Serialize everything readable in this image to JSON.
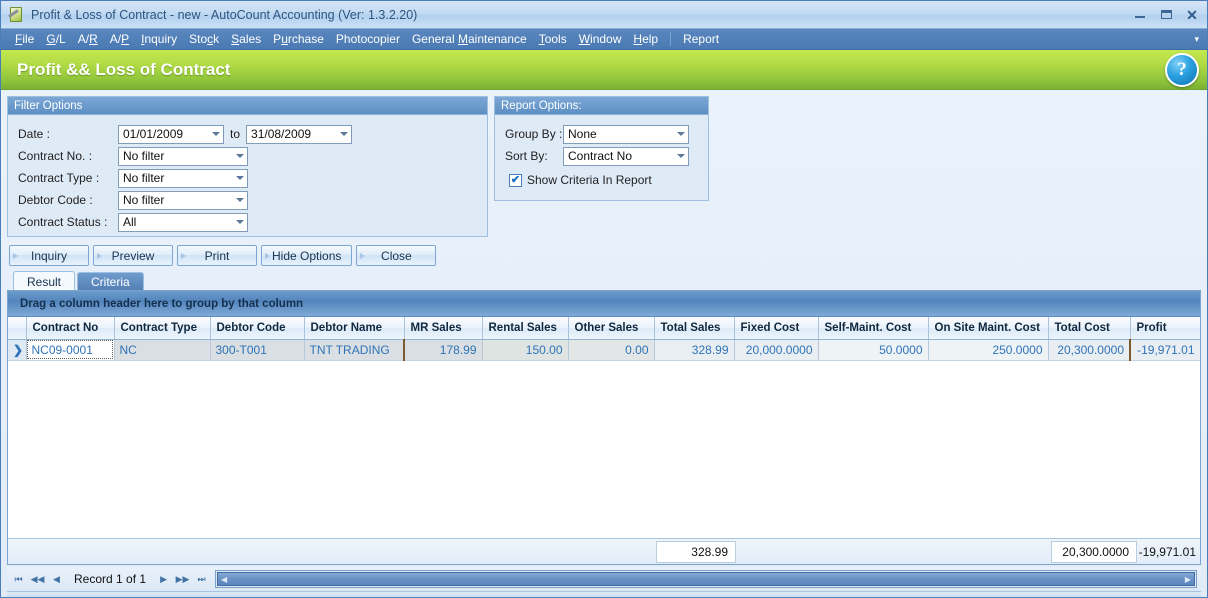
{
  "window": {
    "title": "Profit & Loss of Contract - new - AutoCount Accounting (Ver: 1.3.2.20)",
    "icon": "report-document-icon",
    "minimize": "–",
    "maximize": "□",
    "close": "✕"
  },
  "menubar": {
    "items": [
      {
        "label": "File",
        "accel": "F"
      },
      {
        "label": "G/L",
        "accel": "G"
      },
      {
        "label": "A/R",
        "accel": "R"
      },
      {
        "label": "A/P",
        "accel": "P"
      },
      {
        "label": "Inquiry",
        "accel": "I"
      },
      {
        "label": "Stock",
        "accel": "c"
      },
      {
        "label": "Sales",
        "accel": "S"
      },
      {
        "label": "Purchase",
        "accel": "u"
      },
      {
        "label": "Photocopier",
        "accel": ""
      },
      {
        "label": "General Maintenance",
        "accel": "M"
      },
      {
        "label": "Tools",
        "accel": "T"
      },
      {
        "label": "Window",
        "accel": "W"
      },
      {
        "label": "Help",
        "accel": "H"
      },
      {
        "label": "Report",
        "accel": ""
      }
    ],
    "overflow_chevron": "▾"
  },
  "banner": {
    "title": "Profit && Loss of Contract",
    "help_label": "?",
    "accent_green_top": "#c4e850",
    "accent_green_bottom": "#7cb233"
  },
  "filter_panel": {
    "heading": "Filter Options",
    "date_label": "Date :",
    "date_from": "01/01/2009",
    "date_to": "31/08/2009",
    "to_label": "to",
    "contract_no_label": "Contract No. :",
    "contract_no_value": "No filter",
    "contract_type_label": "Contract Type :",
    "contract_type_value": "No filter",
    "debtor_code_label": "Debtor Code :",
    "debtor_code_value": "No filter",
    "contract_status_label": "Contract Status  :",
    "contract_status_value": "All"
  },
  "report_panel": {
    "heading": "Report Options:",
    "group_by_label": "Group By :",
    "group_by_value": "None",
    "sort_by_label": "Sort By:",
    "sort_by_value": "Contract No",
    "show_criteria_label": "Show Criteria In Report",
    "show_criteria_checked": "✔"
  },
  "buttons": [
    {
      "label": "Inquiry"
    },
    {
      "label": "Preview"
    },
    {
      "label": "Print"
    },
    {
      "label": "Hide Options"
    },
    {
      "label": "Close"
    }
  ],
  "tabs": [
    {
      "label": "Result",
      "active": true
    },
    {
      "label": "Criteria",
      "active": false
    }
  ],
  "grid": {
    "group_panel_text": "Drag a column header here to group by that column",
    "row_indicator": "❯",
    "columns": [
      "Contract No",
      "Contract Type",
      "Debtor Code",
      "Debtor Name",
      "MR Sales",
      "Rental Sales",
      "Other Sales",
      "Total Sales",
      "Fixed Cost",
      "Self-Maint. Cost",
      "On Site Maint. Cost",
      "Total Cost",
      "Profit"
    ],
    "rows": [
      {
        "contract_no": "NC09-0001",
        "contract_type": "NC",
        "debtor_code": "300-T001",
        "debtor_name": "TNT TRADING",
        "mr_sales": "178.99",
        "rental_sales": "150.00",
        "other_sales": "0.00",
        "total_sales": "328.99",
        "fixed_cost": "20,000.0000",
        "self_maint_cost": "50.0000",
        "on_site_maint_cost": "250.0000",
        "total_cost": "20,300.0000",
        "profit": "-19,971.01"
      }
    ],
    "summary": {
      "total_sales": "328.99",
      "total_cost": "20,300.0000",
      "profit": "-19,971.01"
    }
  },
  "navigation": {
    "first": "⏮",
    "prev_page": "◀◀",
    "prev": "◀",
    "record_label": "Record 1 of 1",
    "next": "▶",
    "next_page": "▶▶",
    "last": "⏭",
    "scroll_left_arrow": "◀",
    "scroll_right_arrow": "▶"
  }
}
